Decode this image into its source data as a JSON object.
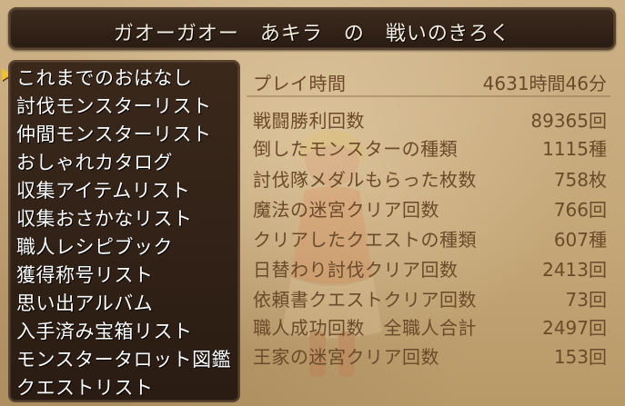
{
  "window": {
    "title": "ガオーガオー　あキラ　の　戦いのきろく"
  },
  "menu": {
    "items": [
      {
        "label": "これまでのおはなし"
      },
      {
        "label": "討伐モンスターリスト"
      },
      {
        "label": "仲間モンスターリスト"
      },
      {
        "label": "おしゃれカタログ"
      },
      {
        "label": "収集アイテムリスト"
      },
      {
        "label": "収集おさかなリスト"
      },
      {
        "label": "職人レシピブック"
      },
      {
        "label": "獲得称号リスト"
      },
      {
        "label": "思い出アルバム"
      },
      {
        "label": "入手済み宝箱リスト"
      },
      {
        "label": "モンスタータロット図鑑"
      },
      {
        "label": "クエストリスト"
      }
    ]
  },
  "playtime": {
    "label": "プレイ時間",
    "value": "4631時間46分"
  },
  "stats": [
    {
      "label": "戦闘勝利回数",
      "value": "89365回"
    },
    {
      "label": "倒したモンスターの種類",
      "value": "1115種"
    },
    {
      "label": "討伐隊メダルもらった枚数",
      "value": "758枚"
    },
    {
      "label": "魔法の迷宮クリア回数",
      "value": "766回"
    },
    {
      "label": "クリアしたクエストの種類",
      "value": "607種"
    },
    {
      "label": "日替わり討伐クリア回数",
      "value": "2413回"
    },
    {
      "label": "依頼書クエストクリア回数",
      "value": "73回"
    },
    {
      "label": "職人成功回数　全職人合計",
      "value": "2497回"
    },
    {
      "label": "王家の迷宮クリア回数",
      "value": "153回"
    }
  ],
  "colors": {
    "parchment": "#c9ad82",
    "panel": "#2a1c13",
    "stat_text": "#6b4a2a",
    "cursor": "#f0c030"
  }
}
